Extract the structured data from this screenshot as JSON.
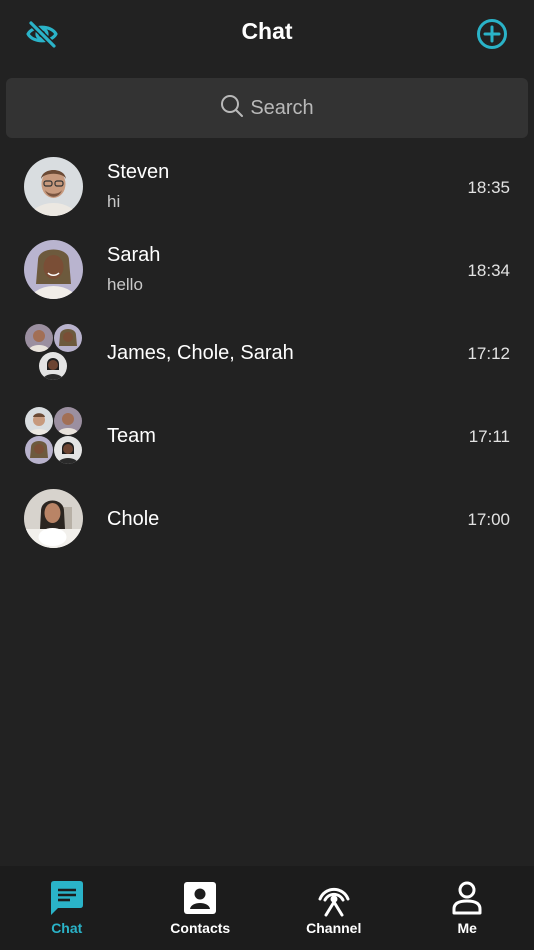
{
  "header": {
    "title": "Chat",
    "left_icon": "eye-off-icon",
    "right_icon": "add-circle-icon",
    "accent": "#2ab3c8"
  },
  "search": {
    "placeholder": "Search",
    "icon": "search-icon"
  },
  "conversations": [
    {
      "name": "Steven",
      "preview": "hi",
      "time": "18:35",
      "avatar": "single"
    },
    {
      "name": "Sarah",
      "preview": "hello",
      "time": "18:34",
      "avatar": "single"
    },
    {
      "name": "James, Chole, Sarah",
      "preview": "",
      "time": "17:12",
      "avatar": "group-3"
    },
    {
      "name": "Team",
      "preview": "",
      "time": "17:11",
      "avatar": "group-4"
    },
    {
      "name": "Chole",
      "preview": "",
      "time": "17:00",
      "avatar": "single"
    }
  ],
  "tabs": [
    {
      "label": "Chat",
      "icon": "chat-bubble-icon",
      "active": true
    },
    {
      "label": "Contacts",
      "icon": "contact-card-icon",
      "active": false
    },
    {
      "label": "Channel",
      "icon": "broadcast-tower-icon",
      "active": false
    },
    {
      "label": "Me",
      "icon": "person-icon",
      "active": false
    }
  ]
}
